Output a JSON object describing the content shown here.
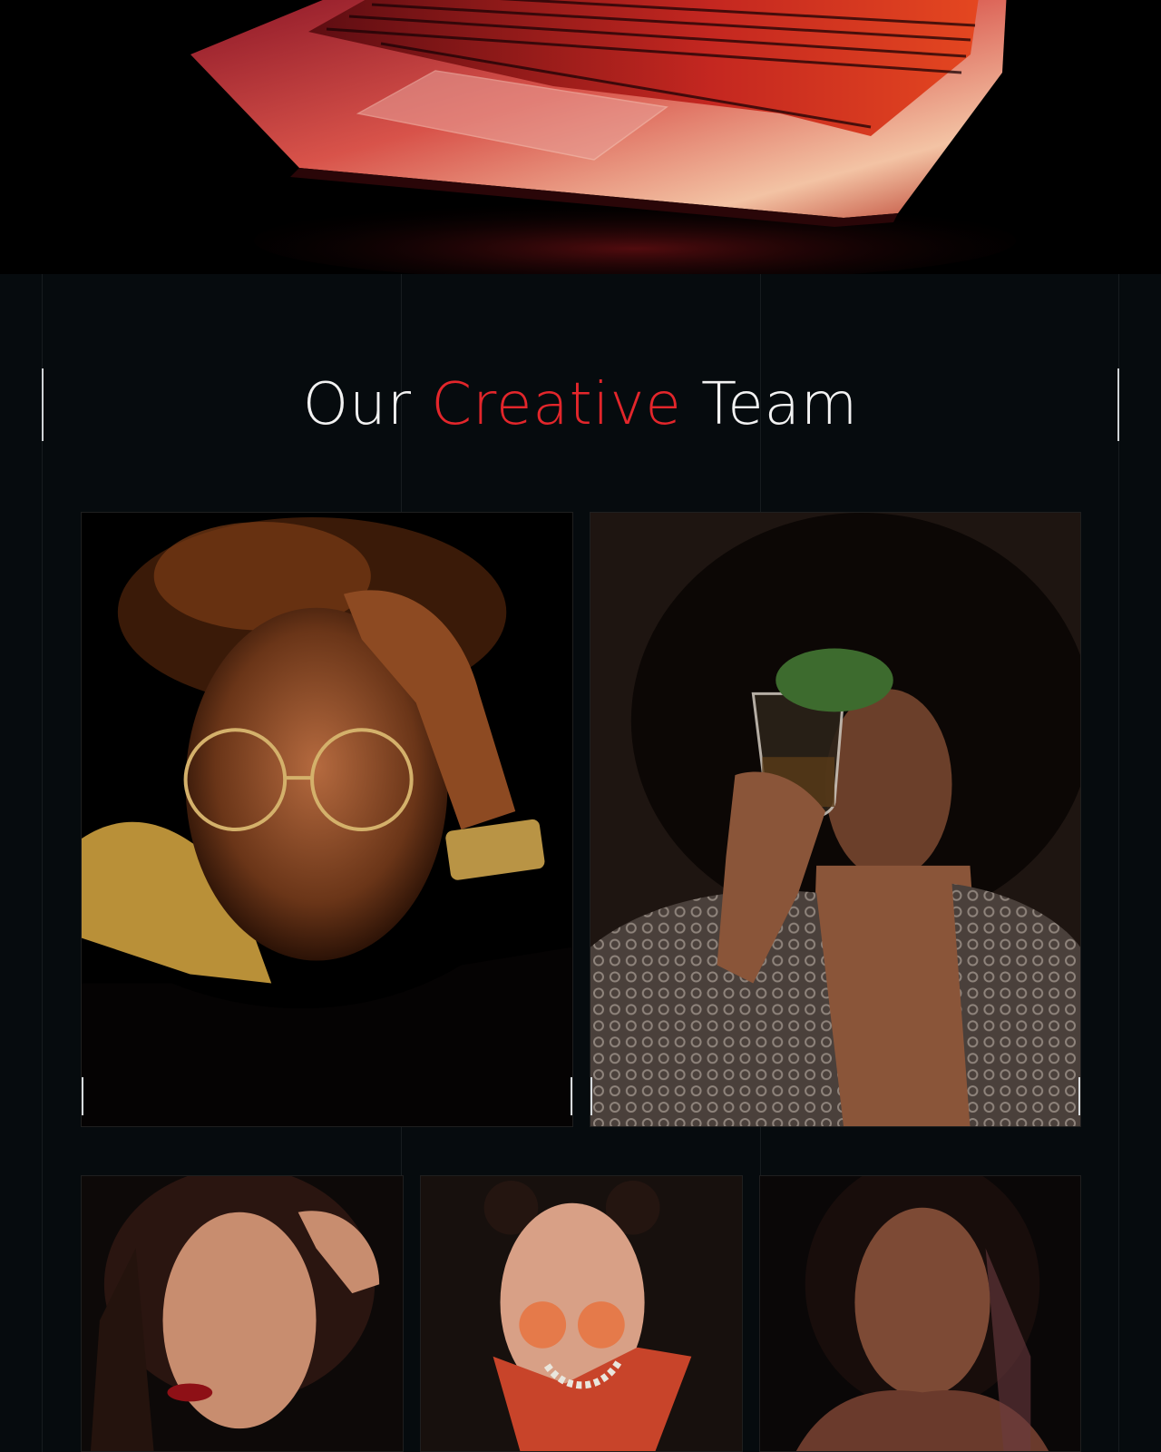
{
  "hero": {
    "image": "laptop-keyboard-red-glow-photo"
  },
  "team": {
    "heading": {
      "before": "Our ",
      "accent": "Creative",
      "after": " Team"
    },
    "accent_color": "#e3262b",
    "members": [
      {
        "photo": "man-glasses-gold-watch-portrait"
      },
      {
        "photo": "man-afro-wine-glass-portrait"
      },
      {
        "photo": "woman-hand-in-hair-portrait"
      },
      {
        "photo": "woman-orange-sunglasses-pearls-portrait"
      },
      {
        "photo": "woman-dark-hair-portrait"
      }
    ]
  }
}
